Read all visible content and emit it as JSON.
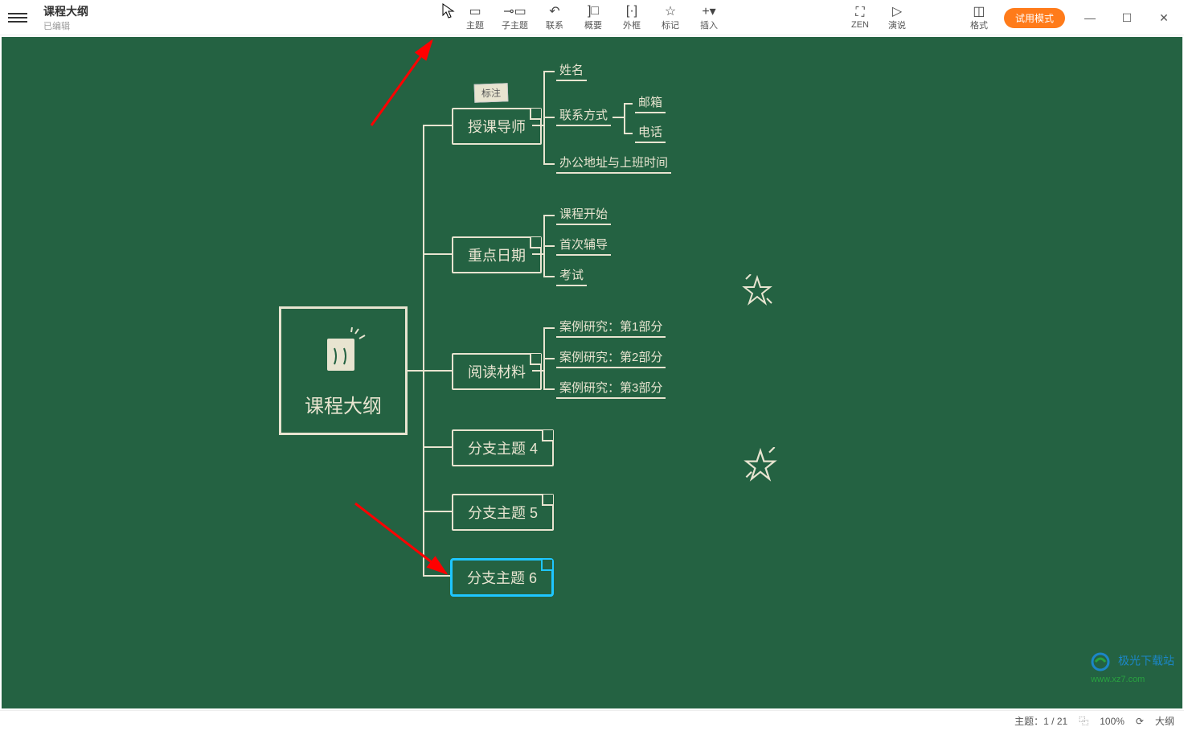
{
  "header": {
    "title": "课程大纲",
    "subtitle": "已编辑"
  },
  "toolbar": {
    "topic": "主题",
    "subtopic": "子主题",
    "relation": "联系",
    "summary": "概要",
    "boundary": "外框",
    "marker": "标记",
    "insert": "插入",
    "zen": "ZEN",
    "pitch": "演说",
    "format": "格式",
    "trial": "试用模式"
  },
  "mindmap": {
    "central": "课程大纲",
    "note_tag": "标注",
    "branches": {
      "b1": {
        "label": "授课导师",
        "children": {
          "c1": "姓名",
          "c2": {
            "label": "联系方式",
            "children": {
              "d1": "邮箱",
              "d2": "电话"
            }
          },
          "c3": "办公地址与上班时间"
        }
      },
      "b2": {
        "label": "重点日期",
        "children": {
          "c1": "课程开始",
          "c2": "首次辅导",
          "c3": "考试"
        }
      },
      "b3": {
        "label": "阅读材料",
        "children": {
          "c1": "案例研究：第1部分",
          "c2": "案例研究：第2部分",
          "c3": "案例研究：第3部分"
        }
      },
      "b4": {
        "label": "分支主题 4"
      },
      "b5": {
        "label": "分支主题 5"
      },
      "b6": {
        "label": "分支主题 6"
      }
    }
  },
  "statusbar": {
    "topic_count": "主题：1 / 21",
    "zoom": "100%",
    "outline": "大纲"
  },
  "watermark": {
    "name": "极光下载站",
    "url": "www.xz7.com"
  }
}
